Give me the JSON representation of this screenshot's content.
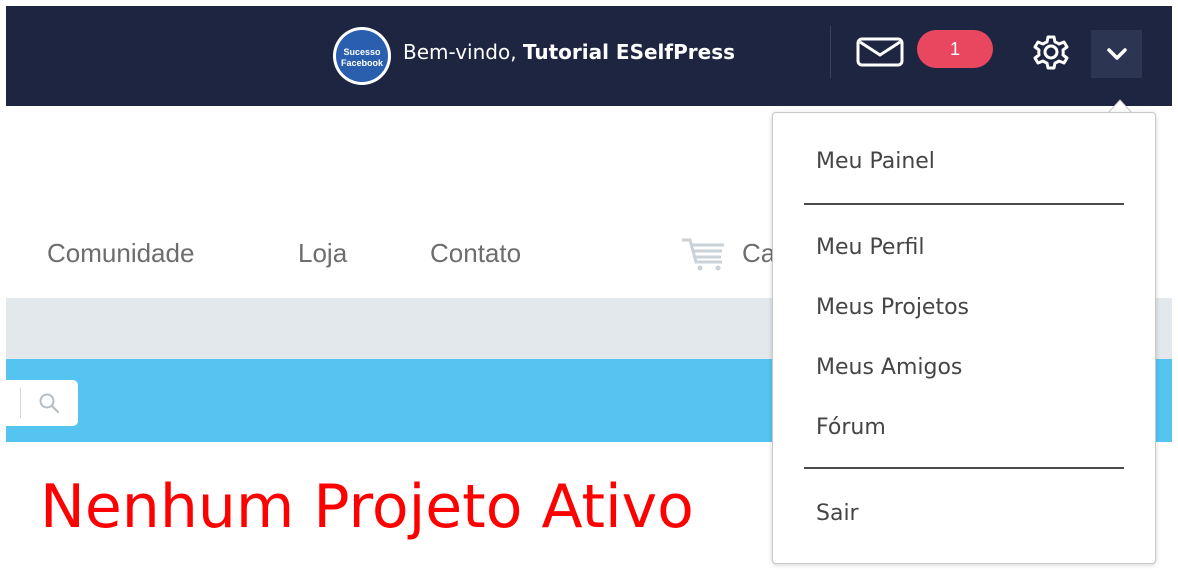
{
  "header": {
    "avatar_text_line1": "Sucesso",
    "avatar_text_line2": "Facebook",
    "welcome_prefix": "Bem-vindo, ",
    "user_name": "Tutorial ESelfPress",
    "notification_count": "1",
    "icons": [
      "mail-icon",
      "gear-icon",
      "chevron-down-icon"
    ],
    "colors": {
      "bar": "#1e2540",
      "badge": "#e8475f",
      "dropdown_button": "#2c3552"
    }
  },
  "nav": {
    "items": [
      "Comunidade",
      "Loja",
      "Contato"
    ],
    "cart_partial_label": "Ca",
    "cart_icon": "cart-icon"
  },
  "search": {
    "icon": "search-icon"
  },
  "main": {
    "heading": "Nenhum Projeto Ativo",
    "heading_color": "#ff0000",
    "band_color": "#56c4f1"
  },
  "user_menu": {
    "items": [
      "Meu Painel",
      "Meu Perfil",
      "Meus Projetos",
      "Meus Amigos",
      "Fórum",
      "Sair"
    ]
  }
}
